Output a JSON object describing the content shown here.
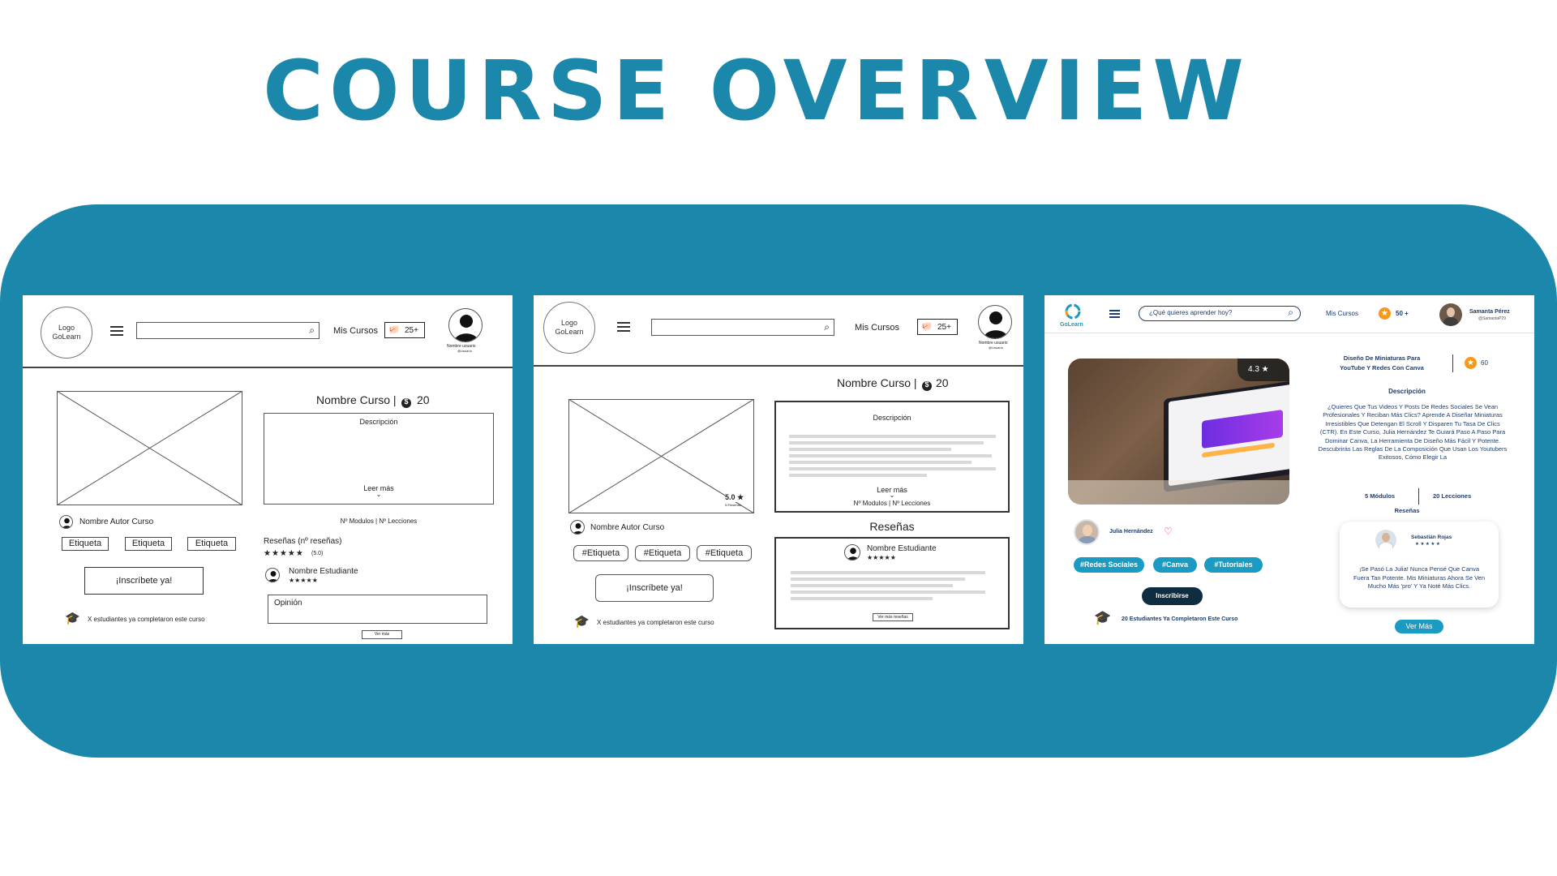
{
  "title": "COURSE OVERVIEW",
  "wireframe1": {
    "logo": "Logo\nGoLearn",
    "mis_cursos": "Mis Cursos",
    "credits": "25+",
    "user_caption": "Nombre usuario",
    "user_handle": "@Usuario",
    "course_name": "Nombre Curso |",
    "course_price": "20",
    "author": "Nombre Autor Curso",
    "tags": [
      "Etiqueta",
      "Etiqueta",
      "Etiqueta"
    ],
    "description_label": "Descripción",
    "read_more": "Leer más",
    "modules_lessons": "Nº Modulos | Nº Lecciones",
    "reviews_heading": "Reseñas (nº reseñas)",
    "rating_stars": "★★★★★",
    "rating_value": "(5.0)",
    "student_name": "Nombre Estudiante",
    "student_stars": "★★★★★",
    "opinion_placeholder": "Opinión",
    "enroll_button": "¡Inscríbete ya!",
    "completed_text": "X estudiantes ya completaron este curso",
    "see_more": "Ver más"
  },
  "wireframe2": {
    "logo": "Logo\nGoLearn",
    "mis_cursos": "Mis Cursos",
    "credits": "25+",
    "user_caption": "Nombre usuario",
    "user_handle": "@Usuario",
    "course_name": "Nombre Curso |",
    "course_price": "20",
    "image_rating": "5.0 ★",
    "image_rating_caption": "N Reseñas",
    "description_label": "Descripción",
    "read_more": "Leer más",
    "modules_lessons": "Nº Modulos | Nº Lecciones",
    "author": "Nombre Autor Curso",
    "tags": [
      "#Etiqueta",
      "#Etiqueta",
      "#Etiqueta"
    ],
    "reviews_heading": "Reseñas",
    "student_name": "Nombre Estudiante",
    "student_stars": "★★★★★",
    "see_reviews": "Ver más reseñas",
    "enroll_button": "¡Inscríbete ya!",
    "completed_text": "X estudiantes ya completaron este curso"
  },
  "hifi": {
    "logo_text": "GoLearn",
    "search_placeholder": "¿Qué quieres aprender hoy?",
    "mis_cursos": "Mis Cursos",
    "credits": "50 +",
    "user_name": "Samanta Pérez",
    "user_handle": "@SamantaP29",
    "image_rating": "4.3 ★",
    "course_title_line1": "Diseño De Miniaturas Para",
    "course_title_line2": "YouTube Y Redes Con Canva",
    "course_price": "60",
    "description_label": "Descripción",
    "description_text": "¿Quieres Que Tus Videos Y Posts De Redes Sociales Se Vean Profesionales Y Reciban Más Clics? Aprende A Diseñar Miniaturas Irresistibles Que Detengan El Scroll Y Disparen Tu Tasa De Clics (CTR). En Este Curso, Julia Hernández Te Guiará Paso A Paso Para Dominar Canva, La Herramienta De Diseño Más Fácil Y Potente. Descubrirás Las Reglas De La Composición Que Usan Los Youtubers Exitosos, Cómo Elegir La",
    "modules": "5 Módulos",
    "lessons": "20 Lecciones",
    "reviews_heading": "Reseñas",
    "reviewer_name": "Sebastián Rojas",
    "reviewer_stars": "★ ★ ★ ★ ★",
    "review_text": "¡Se Pasó La Julia! Nunca Pensé Que Canva Fuera Tan Potente. Mis Miniaturas Ahora Se Ven Mucho Más 'pro' Y Ya Noté Más Clics.",
    "see_more": "Ver Más",
    "author": "Julia Hernández",
    "tags": [
      "#Redes Sociales",
      "#Canva",
      "#Tutoriales"
    ],
    "enroll_button": "Inscribirse",
    "completed_text": "20 Estudiantes Ya Completaron Este Curso",
    "colors": {
      "teal": "#1b9bc2",
      "navy": "#1f3d6e",
      "dark_button": "#0f2d40",
      "orange": "#f39a1d"
    }
  }
}
